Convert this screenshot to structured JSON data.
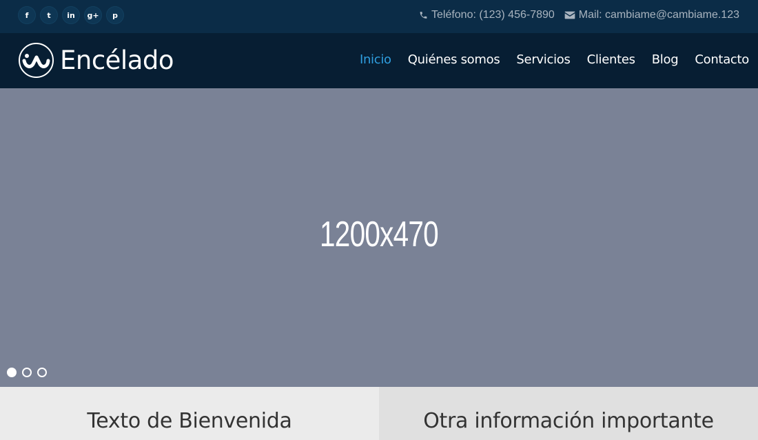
{
  "topbar": {
    "social": [
      {
        "icon": "facebook-icon",
        "glyph": "f"
      },
      {
        "icon": "twitter-icon",
        "glyph": "t"
      },
      {
        "icon": "linkedin-icon",
        "glyph": "in"
      },
      {
        "icon": "google-plus-icon",
        "glyph": "g+"
      },
      {
        "icon": "pinterest-icon",
        "glyph": "p"
      }
    ],
    "phone": "Teléfono: (123) 456-7890",
    "mail": "Mail: cambiame@cambiame.123"
  },
  "header": {
    "logo_text": "Encélado",
    "nav": [
      {
        "label": "Inicio",
        "active": true
      },
      {
        "label": "Quiénes somos",
        "active": false
      },
      {
        "label": "Servicios",
        "active": false
      },
      {
        "label": "Clientes",
        "active": false
      },
      {
        "label": "Blog",
        "active": false
      },
      {
        "label": "Contacto",
        "active": false
      }
    ],
    "active_color": "#2f9fe0"
  },
  "slider": {
    "placeholder_text": "1200x470",
    "slide_count": 3,
    "active_slide": 1,
    "background": "#7a8296"
  },
  "panels": {
    "left_title": "Texto de Bienvenida",
    "right_title": "Otra información importante"
  },
  "colors": {
    "topbar": "#0b2c47",
    "header": "#071e33"
  }
}
